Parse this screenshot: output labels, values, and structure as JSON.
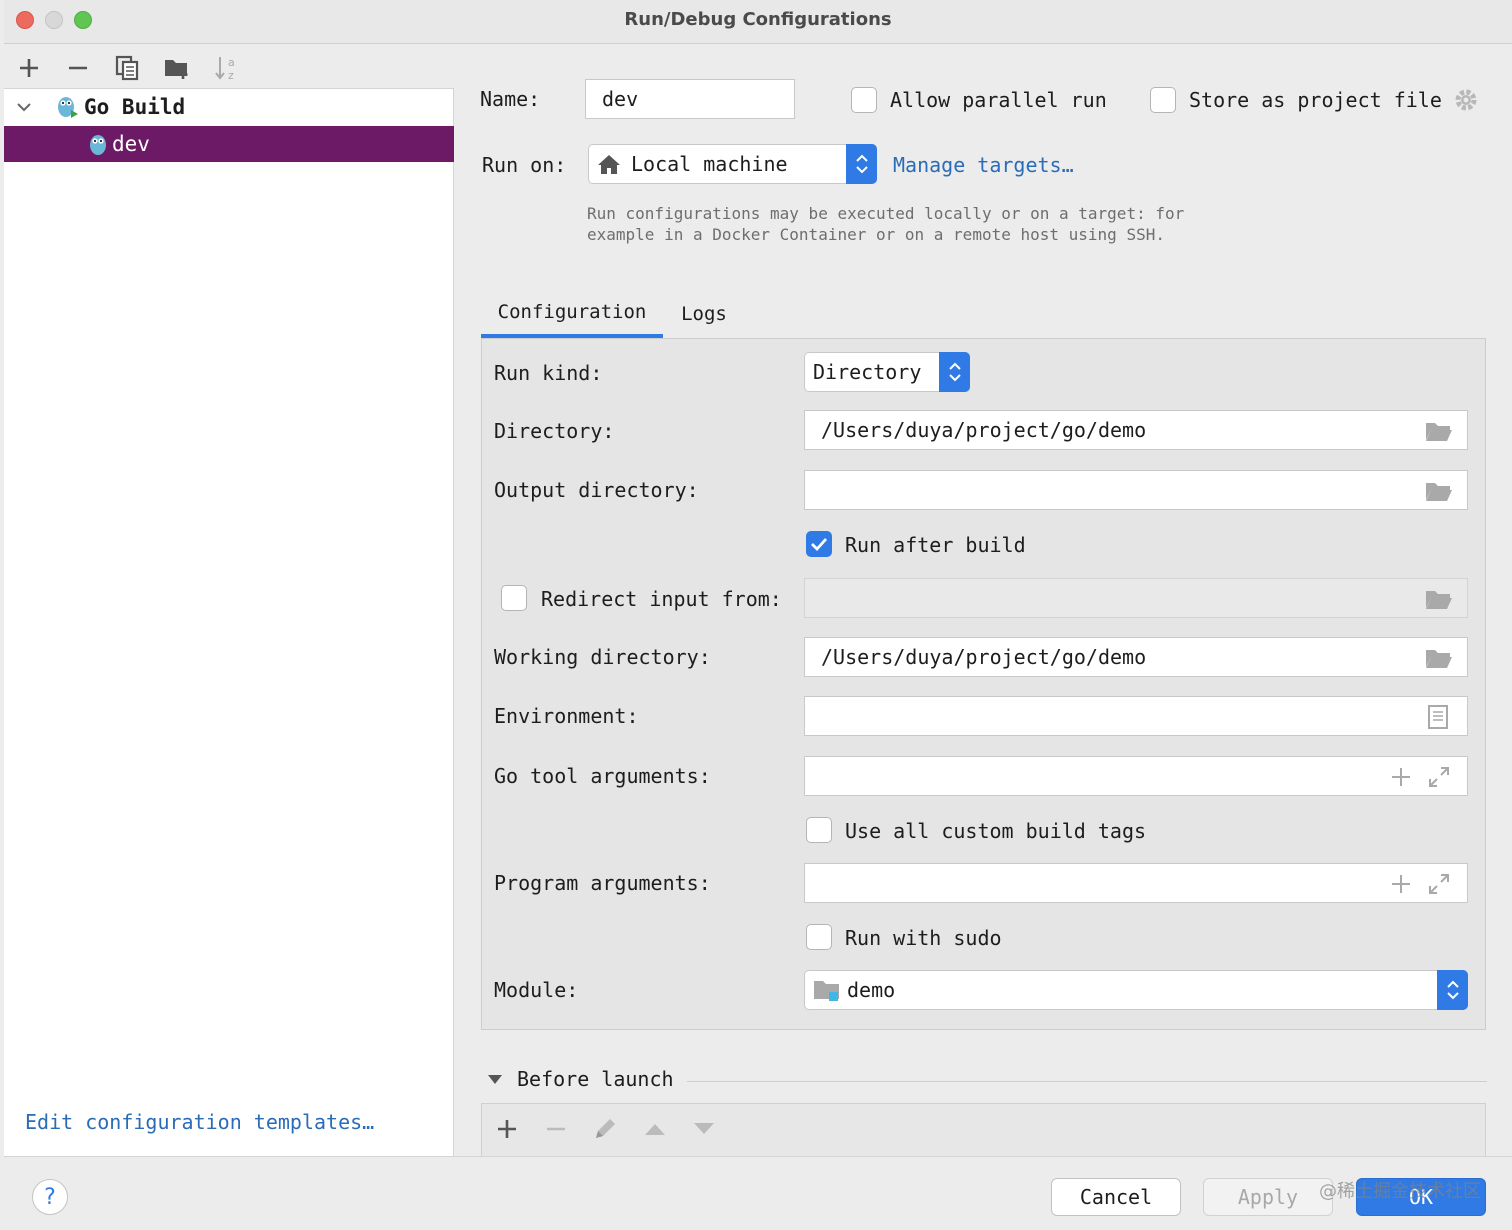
{
  "window": {
    "title": "Run/Debug Configurations"
  },
  "sidebar": {
    "tree": [
      {
        "label": "Go Build",
        "expanded": true,
        "icon": "gopher-run-icon"
      },
      {
        "label": "dev",
        "selected": true,
        "icon": "gopher-icon"
      }
    ],
    "edit_templates": "Edit configuration templates…"
  },
  "form": {
    "name_label": "Name:",
    "name_value": "dev",
    "allow_parallel": {
      "label": "Allow parallel run",
      "checked": false
    },
    "store_project": {
      "label": "Store as project file",
      "checked": false
    },
    "run_on_label": "Run on:",
    "run_on_value": "Local machine",
    "manage_targets": "Manage targets…",
    "hint_line1": "Run configurations may be executed locally or on a target: for",
    "hint_line2": "example in a Docker Container or on a remote host using SSH."
  },
  "tabs": [
    {
      "label": "Configuration",
      "active": true
    },
    {
      "label": "Logs",
      "active": false
    }
  ],
  "config": {
    "run_kind_label": "Run kind:",
    "run_kind_value": "Directory",
    "directory_label": "Directory:",
    "directory_value": "/Users/duya/project/go/demo",
    "output_label": "Output directory:",
    "output_value": "",
    "run_after_build": {
      "label": "Run after build",
      "checked": true
    },
    "redirect_input": {
      "label": "Redirect input from:",
      "checked": false
    },
    "working_dir_label": "Working directory:",
    "working_dir_value": "/Users/duya/project/go/demo",
    "environment_label": "Environment:",
    "go_tool_args_label": "Go tool arguments:",
    "custom_build_tags": {
      "label": "Use all custom build tags",
      "checked": false
    },
    "program_args_label": "Program arguments:",
    "run_with_sudo": {
      "label": "Run with sudo",
      "checked": false
    },
    "module_label": "Module:",
    "module_value": "demo"
  },
  "before_launch": {
    "label": "Before launch"
  },
  "buttons": {
    "help": "?",
    "cancel": "Cancel",
    "apply": "Apply",
    "ok": "OK"
  },
  "watermark": "@稀土掘金技术社区",
  "colors": {
    "accent": "#2f7ae5",
    "selection": "#6c1a66",
    "link": "#2a6cb8"
  }
}
